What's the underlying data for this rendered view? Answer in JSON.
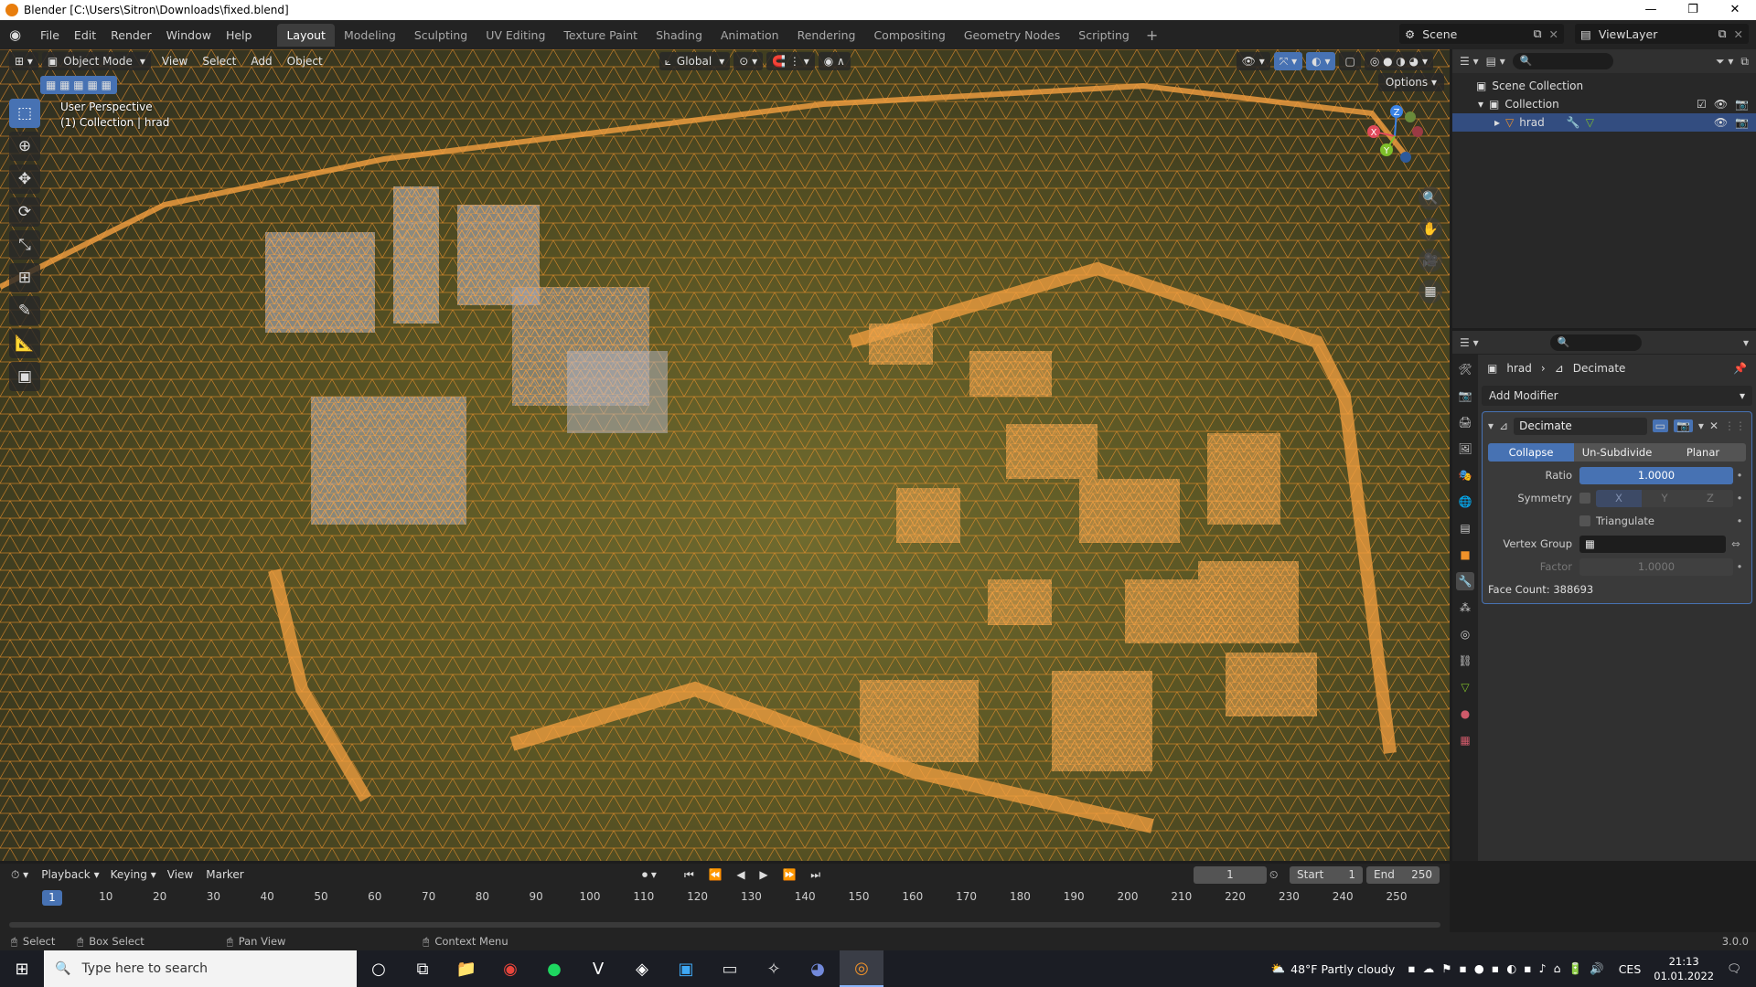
{
  "window": {
    "title": "Blender [C:\\Users\\Sitron\\Downloads\\fixed.blend]",
    "controls": [
      "—",
      "❐",
      "✕"
    ]
  },
  "menu": [
    "File",
    "Edit",
    "Render",
    "Window",
    "Help"
  ],
  "workspaces": [
    "Layout",
    "Modeling",
    "Sculpting",
    "UV Editing",
    "Texture Paint",
    "Shading",
    "Animation",
    "Rendering",
    "Compositing",
    "Geometry Nodes",
    "Scripting"
  ],
  "active_workspace": "Layout",
  "scene": "Scene",
  "view_layer": "ViewLayer",
  "viewport": {
    "mode": "Object Mode",
    "menus": [
      "View",
      "Select",
      "Add",
      "Object"
    ],
    "transform_orientation": "Global",
    "options": "Options",
    "perspective_label": "User Perspective",
    "collection_label": "(1) Collection | hrad",
    "gizmo_axes": [
      "Z",
      "X",
      "Y"
    ],
    "wire_color": "#f0922a"
  },
  "outliner": {
    "rows": [
      {
        "label": "Scene Collection"
      },
      {
        "label": "Collection"
      },
      {
        "label": "hrad"
      }
    ]
  },
  "properties": {
    "breadcrumb": [
      "hrad",
      "Decimate"
    ],
    "add_modifier": "Add Modifier",
    "modifier": {
      "name": "Decimate",
      "modes": [
        "Collapse",
        "Un-Subdivide",
        "Planar"
      ],
      "active_mode": "Collapse",
      "ratio_label": "Ratio",
      "ratio": "1.0000",
      "symmetry_label": "Symmetry",
      "axes": [
        "X",
        "Y",
        "Z"
      ],
      "triangulate_label": "Triangulate",
      "vertex_group_label": "Vertex Group",
      "factor_label": "Factor",
      "factor": "1.0000",
      "face_count": "Face Count: 388693"
    }
  },
  "timeline": {
    "menus": [
      "Playback",
      "Keying",
      "View",
      "Marker"
    ],
    "current_frame": "1",
    "start_label": "Start",
    "start": "1",
    "end_label": "End",
    "end": "250",
    "ticks": [
      "10",
      "20",
      "30",
      "40",
      "50",
      "60",
      "70",
      "80",
      "90",
      "100",
      "110",
      "120",
      "130",
      "140",
      "150",
      "160",
      "170",
      "180",
      "190",
      "200",
      "210",
      "220",
      "230",
      "240",
      "250"
    ]
  },
  "status": {
    "select": "Select",
    "box_select": "Box Select",
    "pan_view": "Pan View",
    "context_menu": "Context Menu",
    "version": "3.0.0"
  },
  "taskbar": {
    "search_placeholder": "Type here to search",
    "weather": "48°F  Partly cloudy",
    "language": "CES",
    "time": "21:13",
    "date": "01.01.2022"
  }
}
